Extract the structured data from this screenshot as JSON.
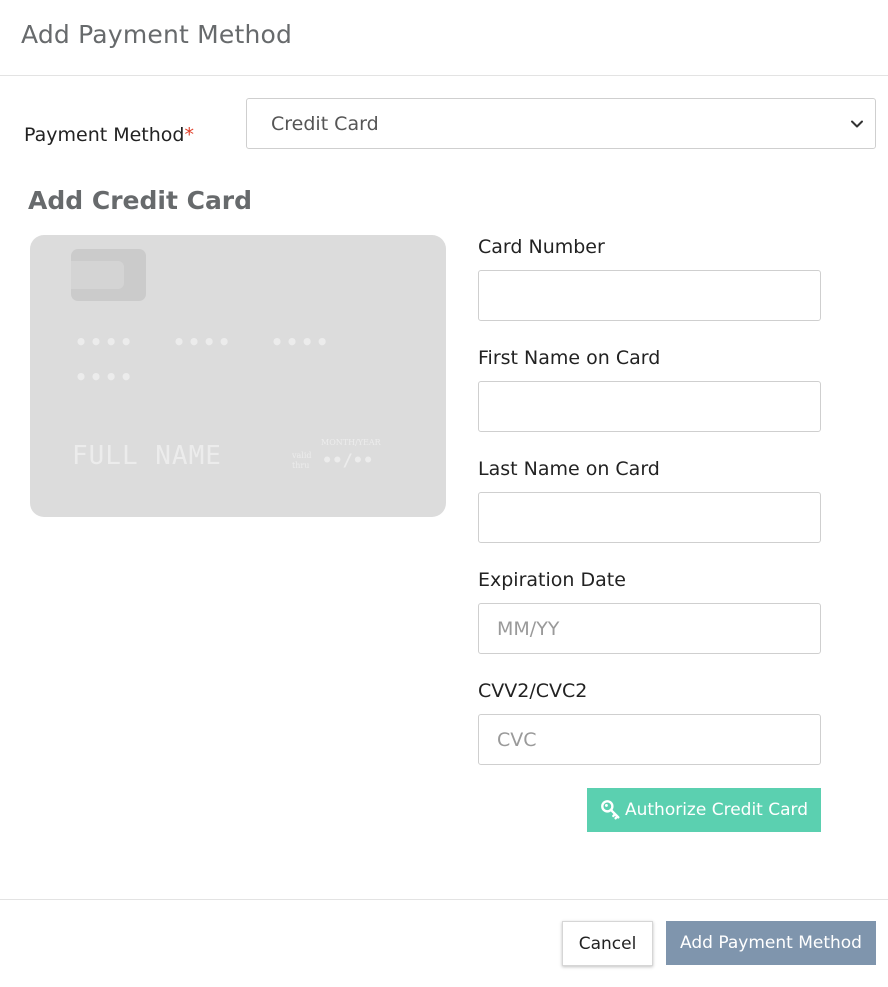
{
  "modal": {
    "title": "Add Payment Method"
  },
  "payment_method": {
    "label": "Payment Method",
    "required_mark": "*",
    "selected": "Credit Card"
  },
  "credit_card": {
    "section_title": "Add Credit Card",
    "preview": {
      "number_group1": "••••",
      "number_group2": "••••",
      "number_group3": "••••",
      "number_group4": "••••",
      "name": "FULL NAME",
      "valid_thru_line1": "valid",
      "valid_thru_line2": "thru",
      "month_year": "MONTH/YEAR",
      "expiry": "••/••"
    },
    "fields": {
      "card_number": {
        "label": "Card Number",
        "value": "",
        "placeholder": ""
      },
      "first_name": {
        "label": "First Name on Card",
        "value": "",
        "placeholder": ""
      },
      "last_name": {
        "label": "Last Name on Card",
        "value": "",
        "placeholder": ""
      },
      "expiration": {
        "label": "Expiration Date",
        "value": "",
        "placeholder": "MM/YY"
      },
      "cvc": {
        "label": "CVV2/CVC2",
        "value": "",
        "placeholder": "CVC"
      }
    },
    "authorize_button": {
      "label": "Authorize Credit Card",
      "icon": "key-icon",
      "color": "#5bd0b0"
    }
  },
  "footer": {
    "cancel_label": "Cancel",
    "submit_label": "Add Payment Method",
    "submit_color": "#7f95ad"
  }
}
